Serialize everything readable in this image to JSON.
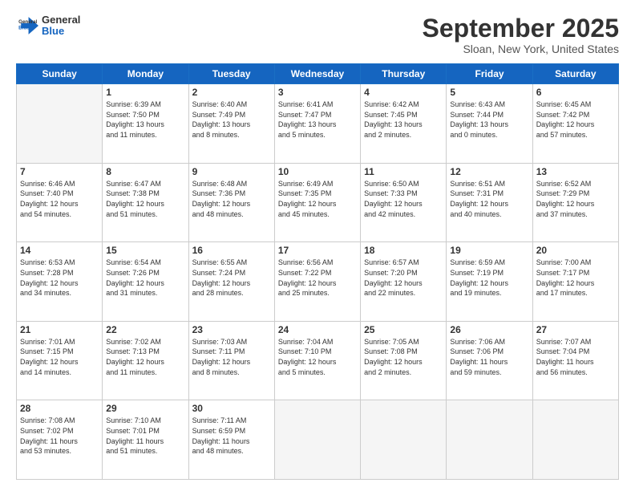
{
  "header": {
    "logo": "GeneralBlue",
    "month": "September 2025",
    "location": "Sloan, New York, United States"
  },
  "days_of_week": [
    "Sunday",
    "Monday",
    "Tuesday",
    "Wednesday",
    "Thursday",
    "Friday",
    "Saturday"
  ],
  "weeks": [
    [
      {
        "day": "",
        "content": ""
      },
      {
        "day": "1",
        "content": "Sunrise: 6:39 AM\nSunset: 7:50 PM\nDaylight: 13 hours\nand 11 minutes."
      },
      {
        "day": "2",
        "content": "Sunrise: 6:40 AM\nSunset: 7:49 PM\nDaylight: 13 hours\nand 8 minutes."
      },
      {
        "day": "3",
        "content": "Sunrise: 6:41 AM\nSunset: 7:47 PM\nDaylight: 13 hours\nand 5 minutes."
      },
      {
        "day": "4",
        "content": "Sunrise: 6:42 AM\nSunset: 7:45 PM\nDaylight: 13 hours\nand 2 minutes."
      },
      {
        "day": "5",
        "content": "Sunrise: 6:43 AM\nSunset: 7:44 PM\nDaylight: 13 hours\nand 0 minutes."
      },
      {
        "day": "6",
        "content": "Sunrise: 6:45 AM\nSunset: 7:42 PM\nDaylight: 12 hours\nand 57 minutes."
      }
    ],
    [
      {
        "day": "7",
        "content": "Sunrise: 6:46 AM\nSunset: 7:40 PM\nDaylight: 12 hours\nand 54 minutes."
      },
      {
        "day": "8",
        "content": "Sunrise: 6:47 AM\nSunset: 7:38 PM\nDaylight: 12 hours\nand 51 minutes."
      },
      {
        "day": "9",
        "content": "Sunrise: 6:48 AM\nSunset: 7:36 PM\nDaylight: 12 hours\nand 48 minutes."
      },
      {
        "day": "10",
        "content": "Sunrise: 6:49 AM\nSunset: 7:35 PM\nDaylight: 12 hours\nand 45 minutes."
      },
      {
        "day": "11",
        "content": "Sunrise: 6:50 AM\nSunset: 7:33 PM\nDaylight: 12 hours\nand 42 minutes."
      },
      {
        "day": "12",
        "content": "Sunrise: 6:51 AM\nSunset: 7:31 PM\nDaylight: 12 hours\nand 40 minutes."
      },
      {
        "day": "13",
        "content": "Sunrise: 6:52 AM\nSunset: 7:29 PM\nDaylight: 12 hours\nand 37 minutes."
      }
    ],
    [
      {
        "day": "14",
        "content": "Sunrise: 6:53 AM\nSunset: 7:28 PM\nDaylight: 12 hours\nand 34 minutes."
      },
      {
        "day": "15",
        "content": "Sunrise: 6:54 AM\nSunset: 7:26 PM\nDaylight: 12 hours\nand 31 minutes."
      },
      {
        "day": "16",
        "content": "Sunrise: 6:55 AM\nSunset: 7:24 PM\nDaylight: 12 hours\nand 28 minutes."
      },
      {
        "day": "17",
        "content": "Sunrise: 6:56 AM\nSunset: 7:22 PM\nDaylight: 12 hours\nand 25 minutes."
      },
      {
        "day": "18",
        "content": "Sunrise: 6:57 AM\nSunset: 7:20 PM\nDaylight: 12 hours\nand 22 minutes."
      },
      {
        "day": "19",
        "content": "Sunrise: 6:59 AM\nSunset: 7:19 PM\nDaylight: 12 hours\nand 19 minutes."
      },
      {
        "day": "20",
        "content": "Sunrise: 7:00 AM\nSunset: 7:17 PM\nDaylight: 12 hours\nand 17 minutes."
      }
    ],
    [
      {
        "day": "21",
        "content": "Sunrise: 7:01 AM\nSunset: 7:15 PM\nDaylight: 12 hours\nand 14 minutes."
      },
      {
        "day": "22",
        "content": "Sunrise: 7:02 AM\nSunset: 7:13 PM\nDaylight: 12 hours\nand 11 minutes."
      },
      {
        "day": "23",
        "content": "Sunrise: 7:03 AM\nSunset: 7:11 PM\nDaylight: 12 hours\nand 8 minutes."
      },
      {
        "day": "24",
        "content": "Sunrise: 7:04 AM\nSunset: 7:10 PM\nDaylight: 12 hours\nand 5 minutes."
      },
      {
        "day": "25",
        "content": "Sunrise: 7:05 AM\nSunset: 7:08 PM\nDaylight: 12 hours\nand 2 minutes."
      },
      {
        "day": "26",
        "content": "Sunrise: 7:06 AM\nSunset: 7:06 PM\nDaylight: 11 hours\nand 59 minutes."
      },
      {
        "day": "27",
        "content": "Sunrise: 7:07 AM\nSunset: 7:04 PM\nDaylight: 11 hours\nand 56 minutes."
      }
    ],
    [
      {
        "day": "28",
        "content": "Sunrise: 7:08 AM\nSunset: 7:02 PM\nDaylight: 11 hours\nand 53 minutes."
      },
      {
        "day": "29",
        "content": "Sunrise: 7:10 AM\nSunset: 7:01 PM\nDaylight: 11 hours\nand 51 minutes."
      },
      {
        "day": "30",
        "content": "Sunrise: 7:11 AM\nSunset: 6:59 PM\nDaylight: 11 hours\nand 48 minutes."
      },
      {
        "day": "",
        "content": ""
      },
      {
        "day": "",
        "content": ""
      },
      {
        "day": "",
        "content": ""
      },
      {
        "day": "",
        "content": ""
      }
    ]
  ]
}
